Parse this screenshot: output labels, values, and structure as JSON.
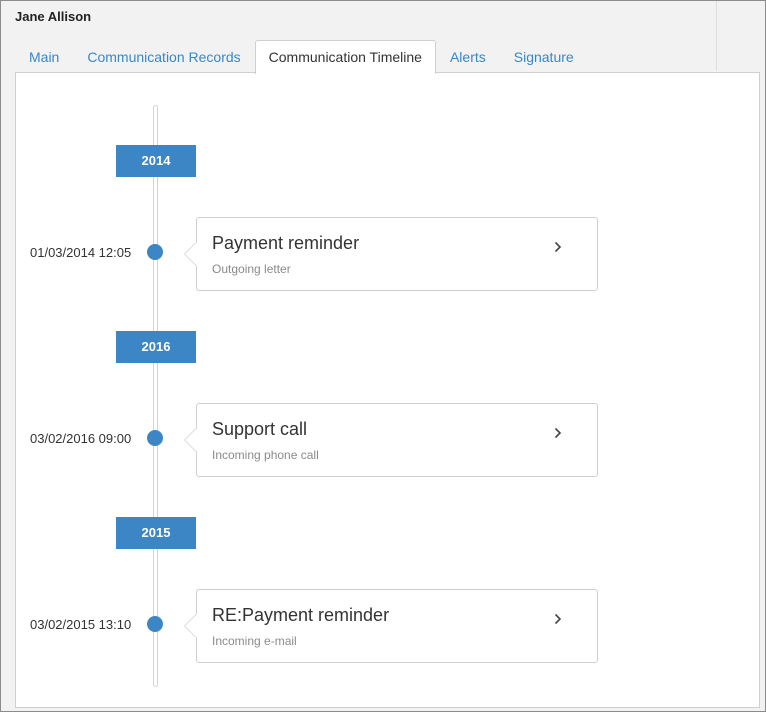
{
  "window": {
    "title": "Jane Allison"
  },
  "tabs": [
    {
      "label": "Main",
      "active": false
    },
    {
      "label": "Communication Records",
      "active": false
    },
    {
      "label": "Communication Timeline",
      "active": true
    },
    {
      "label": "Alerts",
      "active": false
    },
    {
      "label": "Signature",
      "active": false
    }
  ],
  "timeline": {
    "groups": [
      {
        "year": "2014",
        "entries": [
          {
            "datetime": "01/03/2014 12:05",
            "title": "Payment reminder",
            "subtitle": "Outgoing letter",
            "icon": "chevron-right-icon"
          }
        ]
      },
      {
        "year": "2016",
        "entries": [
          {
            "datetime": "03/02/2016 09:00",
            "title": "Support call",
            "subtitle": "Incoming phone call",
            "icon": "chevron-right-icon"
          }
        ]
      },
      {
        "year": "2015",
        "entries": [
          {
            "datetime": "03/02/2015 13:10",
            "title": "RE:Payment reminder",
            "subtitle": "Incoming e-mail",
            "icon": "chevron-right-icon"
          }
        ]
      }
    ]
  },
  "colors": {
    "accent": "#3d86c6",
    "tab_link": "#3a87c6"
  }
}
